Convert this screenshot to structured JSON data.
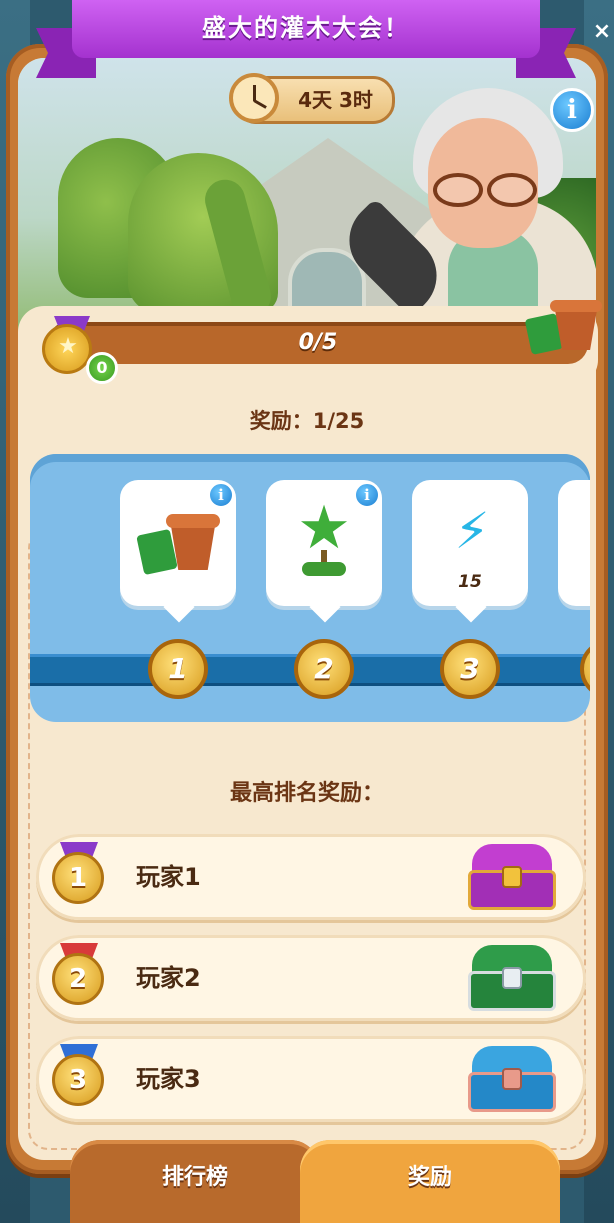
{
  "event": {
    "title": "盛大的灌木大会！",
    "timer": "4天 3时"
  },
  "progress": {
    "text": "0/5",
    "fraction": 0,
    "medal_count": "0"
  },
  "rewards": {
    "label": "奖励：1/25",
    "tiers": [
      {
        "level": "1",
        "item": "seed-pot-icon",
        "value": ""
      },
      {
        "level": "2",
        "item": "topiary-icon",
        "value": ""
      },
      {
        "level": "3",
        "item": "lightning-icon",
        "value": "15"
      }
    ]
  },
  "top_rank": {
    "header": "最高排名奖励：",
    "rows": [
      {
        "rank": "1",
        "name": "玩家1",
        "chest": "purple-chest-icon"
      },
      {
        "rank": "2",
        "name": "玩家2",
        "chest": "green-chest-icon"
      },
      {
        "rank": "3",
        "name": "玩家3",
        "chest": "blue-chest-icon"
      }
    ]
  },
  "tabs": {
    "leaderboard": "排行榜",
    "rewards": "奖励"
  },
  "icons": {
    "close": "×",
    "info": "i"
  },
  "colors": {
    "banner": "#b03cd8",
    "panel": "#c77a35",
    "track": "#7fbce8"
  }
}
